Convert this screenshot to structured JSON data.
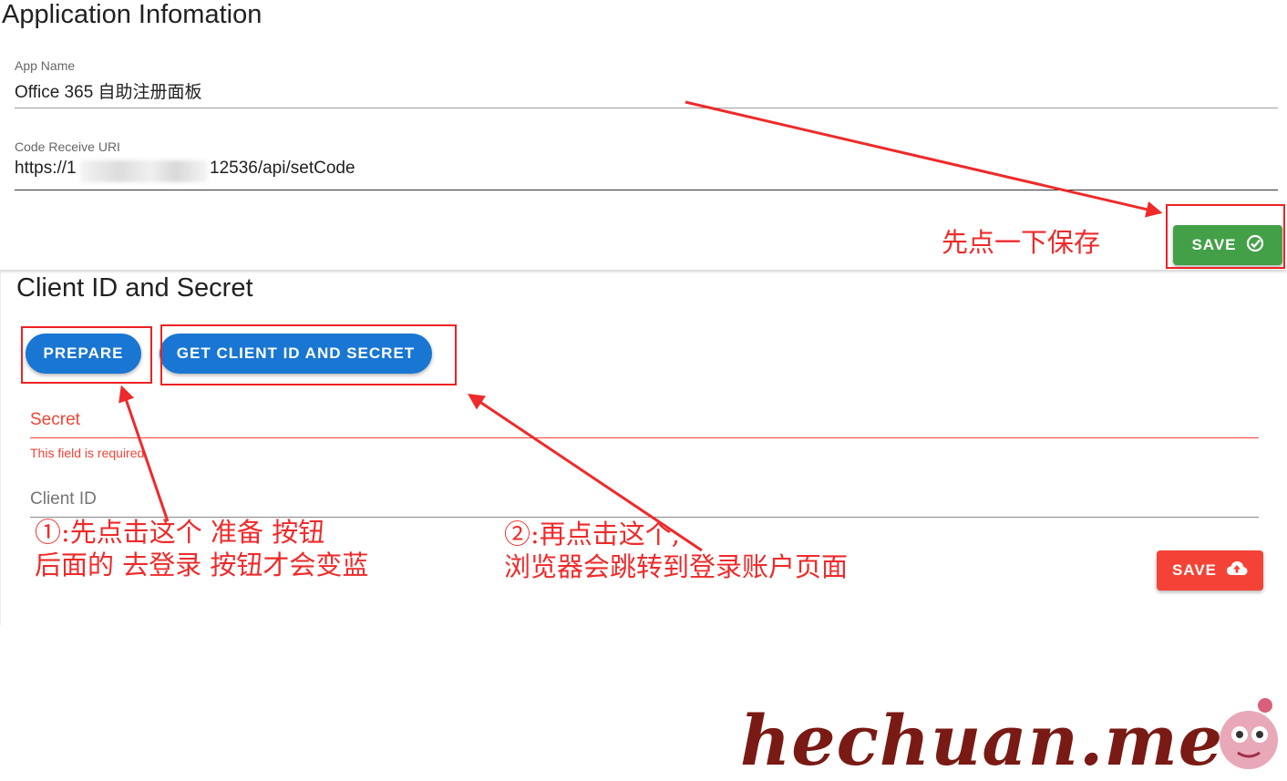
{
  "app_info": {
    "title": "Application Infomation",
    "app_name": {
      "label": "App Name",
      "value": "Office 365 自助注册面板"
    },
    "code_uri": {
      "label": "Code Receive URI",
      "value_start": "https://1",
      "value_end": "12536/api/setCode"
    },
    "save_label": "SAVE",
    "save_icon": "check-circle-icon"
  },
  "client": {
    "title": "Client ID and Secret",
    "prepare_label": "PREPARE",
    "get_label": "GET CLIENT ID AND SECRET",
    "secret": {
      "label": "Secret",
      "error": "This field is required"
    },
    "client_id": {
      "label": "Client ID"
    },
    "save_label": "SAVE",
    "save_icon": "cloud-upload-icon"
  },
  "annotations": {
    "save_hint": "先点一下保存",
    "step1_line1": "①:先点击这个  准备  按钮",
    "step1_line2": "后面的  去登录  按钮才会变蓝",
    "step2_line1": "②:再点击这个,",
    "step2_line2": "浏览器会跳转到登录账户页面"
  },
  "watermark": {
    "text": "hechuan.me"
  },
  "colors": {
    "primary_blue": "#1976d2",
    "success_green": "#43a047",
    "error_red": "#f44336",
    "annotation_red": "#ee2a2a"
  }
}
